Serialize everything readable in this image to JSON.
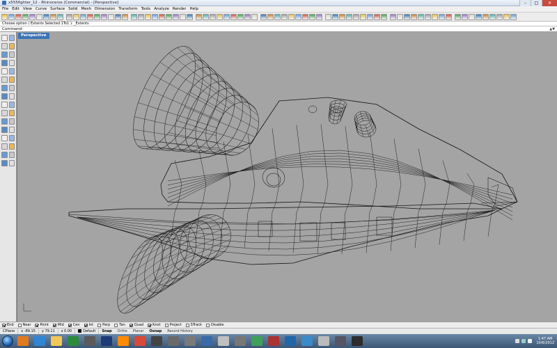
{
  "window": {
    "title": "x555fighter_12 - Rhinoceros (Commercial) - [Perspective]",
    "controls": [
      "–",
      "□",
      "✕"
    ]
  },
  "menu": [
    "File",
    "Edit",
    "View",
    "Curve",
    "Surface",
    "Solid",
    "Mesh",
    "Dimension",
    "Transform",
    "Tools",
    "Analyze",
    "Render",
    "Help"
  ],
  "command_history": "Choose option ( Extents  Selected  1To1 ): _Extents",
  "command_prompt": "Command:",
  "viewport": {
    "tab_label": "Perspective",
    "background": "#a4a4a4",
    "wire_color": "#111111"
  },
  "osnaps": [
    {
      "label": "End",
      "checked": true
    },
    {
      "label": "Near",
      "checked": false
    },
    {
      "label": "Point",
      "checked": true
    },
    {
      "label": "Mid",
      "checked": true
    },
    {
      "label": "Cen",
      "checked": true
    },
    {
      "label": "Int",
      "checked": true
    },
    {
      "label": "Perp",
      "checked": false
    },
    {
      "label": "Tan",
      "checked": false
    },
    {
      "label": "Quad",
      "checked": true
    },
    {
      "label": "Knot",
      "checked": true
    },
    {
      "label": "Project",
      "checked": false
    },
    {
      "label": "STrack",
      "checked": false
    },
    {
      "label": "Disable",
      "checked": false
    }
  ],
  "status": {
    "cplane": "CPlane",
    "x": "x -89.15",
    "y": "y 79.11",
    "z": "z 0.00",
    "layer": "Default",
    "toggles": [
      "Snap",
      "Ortho",
      "Planar",
      "Osnap",
      "Record History"
    ]
  },
  "taskbar": {
    "apps": [
      "firefox-icon",
      "ie-icon",
      "explorer-icon",
      "media-icon",
      "app-icon",
      "photoshop-icon",
      "vlc-icon",
      "chrome-icon",
      "app-icon",
      "app-icon",
      "rhino-icon",
      "app-icon",
      "app-icon",
      "app-icon",
      "app-icon",
      "app-icon",
      "app-icon",
      "app-icon",
      "app-icon",
      "app-icon",
      "app-icon"
    ],
    "app_colors": [
      "#e07a1f",
      "#2f86d3",
      "#f2c75a",
      "#2c8a3d",
      "#5a5a5a",
      "#1e3a78",
      "#ff8a00",
      "#d54a3a",
      "#444",
      "#6a6a6a",
      "#7a7a7a",
      "#3b6aa8",
      "#c0c0c0",
      "#777",
      "#3fa05a",
      "#aa3333",
      "#2266aa",
      "#3c8ac8",
      "#bbb",
      "#556",
      "#2d2d2d"
    ],
    "time": "1:47 AM",
    "date": "10/6/2012"
  }
}
